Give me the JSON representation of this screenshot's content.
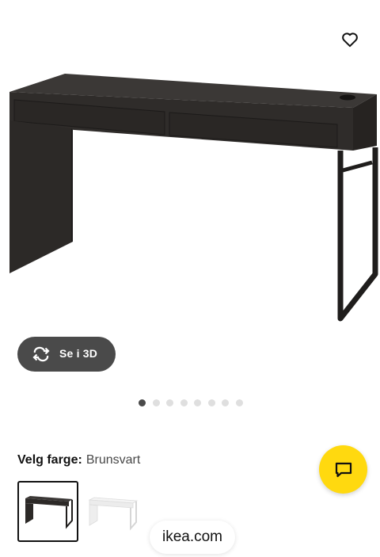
{
  "product": {
    "image": "micke-desk-black-brown"
  },
  "actions": {
    "favourite_icon": "heart-icon",
    "view_3d_icon": "rotate-icon",
    "view_3d_label": "Se i 3D"
  },
  "gallery": {
    "dot_count": 8,
    "active_index": 0
  },
  "color": {
    "label": "Velg farge:",
    "value": "Brunsvart",
    "options": [
      "black-brown",
      "white"
    ],
    "selected_index": 0
  },
  "chat": {
    "icon": "chat-icon",
    "color": "#ffd90f"
  },
  "browser": {
    "url": "ikea.com"
  }
}
